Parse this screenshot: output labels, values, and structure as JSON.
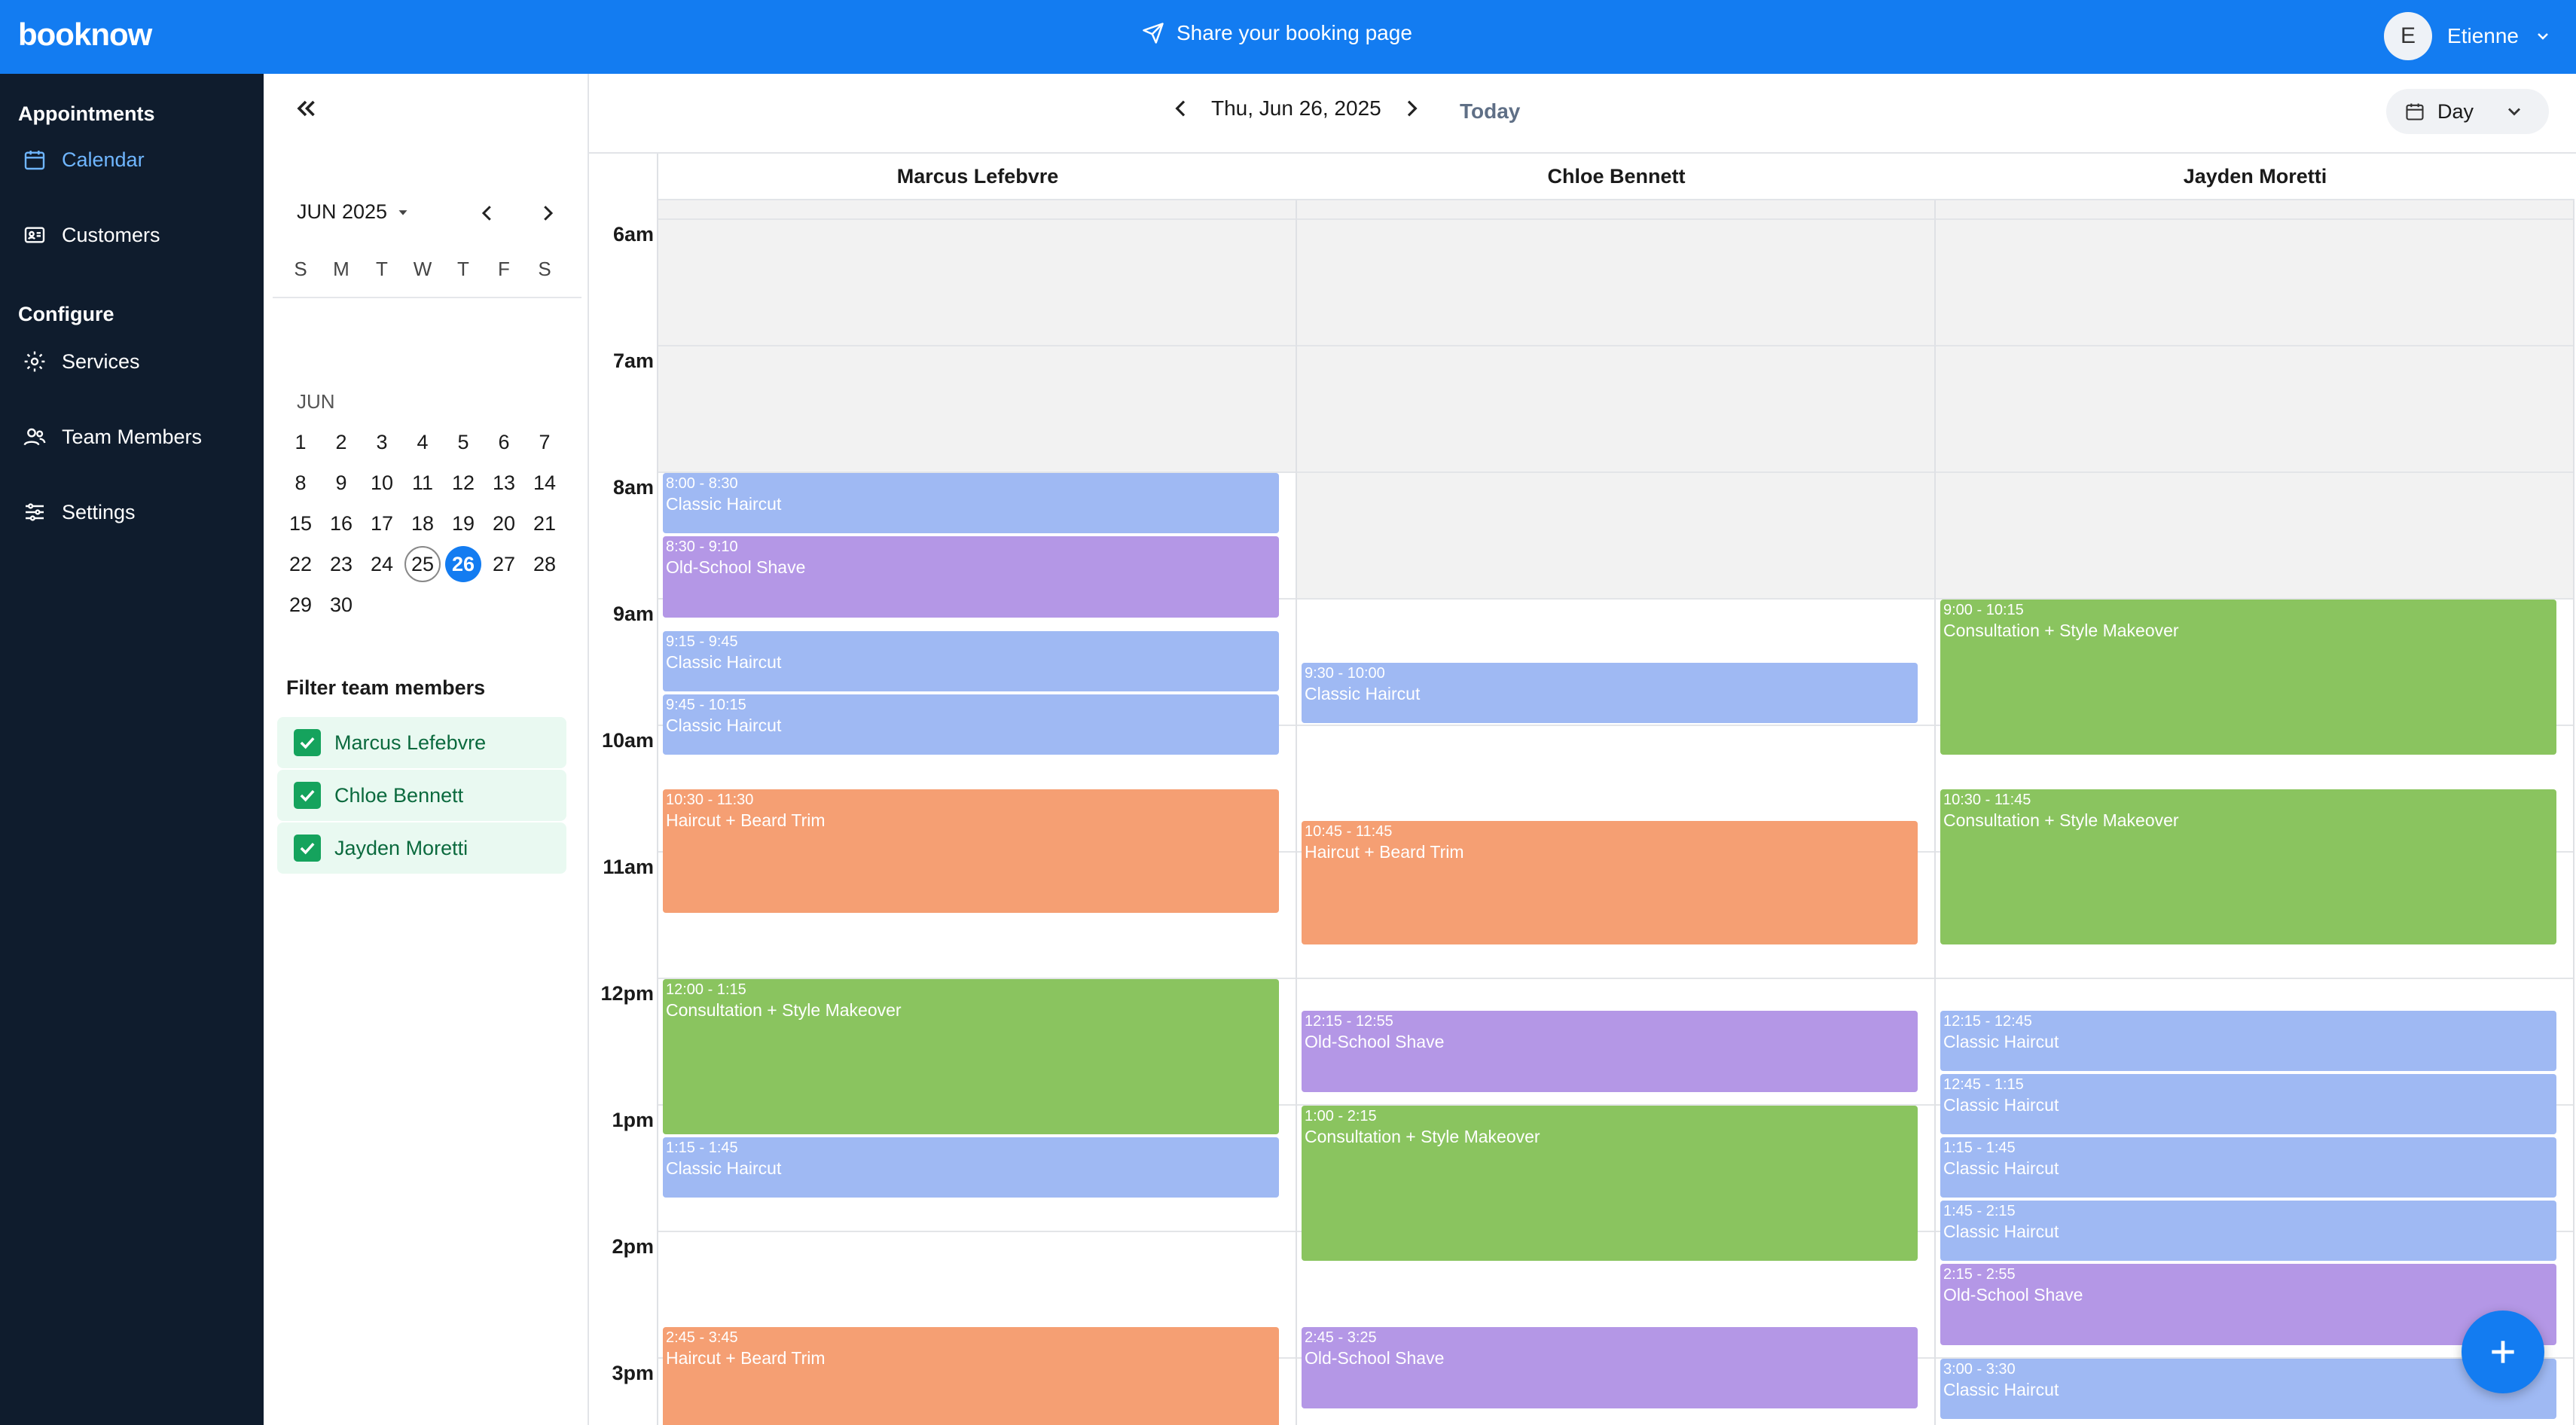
{
  "app": {
    "logo": "booknow",
    "share_label": "Share your booking page",
    "user_initial": "E",
    "user_name": "Etienne"
  },
  "sidebar": {
    "sections": [
      "Appointments",
      "Configure"
    ],
    "items": [
      {
        "label": "Calendar",
        "icon": "calendar-icon",
        "active": true
      },
      {
        "label": "Customers",
        "icon": "id-card-icon"
      },
      {
        "label": "Services",
        "icon": "gear-icon"
      },
      {
        "label": "Team Members",
        "icon": "users-icon"
      },
      {
        "label": "Settings",
        "icon": "sliders-icon"
      }
    ]
  },
  "mini_calendar": {
    "month_label": "JUN 2025",
    "weekdays": [
      "S",
      "M",
      "T",
      "W",
      "T",
      "F",
      "S"
    ],
    "month_short": "JUN",
    "days": [
      "1",
      "2",
      "3",
      "4",
      "5",
      "6",
      "7",
      "8",
      "9",
      "10",
      "11",
      "12",
      "13",
      "14",
      "15",
      "16",
      "17",
      "18",
      "19",
      "20",
      "21",
      "22",
      "23",
      "24",
      "25",
      "26",
      "27",
      "28",
      "29",
      "30"
    ],
    "today": "25",
    "selected": "26"
  },
  "filter": {
    "title": "Filter team members",
    "members": [
      "Marcus Lefebvre",
      "Chloe Bennett",
      "Jayden Moretti"
    ]
  },
  "datebar": {
    "date_label": "Thu, Jun 26, 2025",
    "today_label": "Today",
    "view_label": "Day"
  },
  "hours": [
    "6am",
    "7am",
    "8am",
    "9am",
    "10am",
    "11am",
    "12pm",
    "1pm",
    "2pm",
    "3pm"
  ],
  "columns": [
    {
      "name": "Marcus Lefebvre",
      "available_from": 8,
      "appointments": [
        {
          "time": "8:00 - 8:30",
          "service": "Classic Haircut",
          "start": 8.0,
          "end": 8.5,
          "kind": "haircut"
        },
        {
          "time": "8:30 - 9:10",
          "service": "Old-School Shave",
          "start": 8.5,
          "end": 9.1667,
          "kind": "shave"
        },
        {
          "time": "9:15 - 9:45",
          "service": "Classic Haircut",
          "start": 9.25,
          "end": 9.75,
          "kind": "haircut"
        },
        {
          "time": "9:45 - 10:15",
          "service": "Classic Haircut",
          "start": 9.75,
          "end": 10.25,
          "kind": "haircut"
        },
        {
          "time": "10:30 - 11:30",
          "service": "Haircut + Beard Trim",
          "start": 10.5,
          "end": 11.5,
          "kind": "beard"
        },
        {
          "time": "12:00 - 1:15",
          "service": "Consultation + Style Makeover",
          "start": 12.0,
          "end": 13.25,
          "kind": "consult"
        },
        {
          "time": "1:15 - 1:45",
          "service": "Classic Haircut",
          "start": 13.25,
          "end": 13.75,
          "kind": "haircut"
        },
        {
          "time": "2:45 - 3:45",
          "service": "Haircut + Beard Trim",
          "start": 14.75,
          "end": 15.75,
          "kind": "beard"
        }
      ]
    },
    {
      "name": "Chloe Bennett",
      "available_from": 9,
      "appointments": [
        {
          "time": "9:30 - 10:00",
          "service": "Classic Haircut",
          "start": 9.5,
          "end": 10.0,
          "kind": "haircut"
        },
        {
          "time": "10:45 - 11:45",
          "service": "Haircut + Beard Trim",
          "start": 10.75,
          "end": 11.75,
          "kind": "beard"
        },
        {
          "time": "12:15 - 12:55",
          "service": "Old-School Shave",
          "start": 12.25,
          "end": 12.9167,
          "kind": "shave"
        },
        {
          "time": "1:00 - 2:15",
          "service": "Consultation + Style Makeover",
          "start": 13.0,
          "end": 14.25,
          "kind": "consult"
        },
        {
          "time": "2:45 - 3:25",
          "service": "Old-School Shave",
          "start": 14.75,
          "end": 15.4167,
          "kind": "shave"
        }
      ]
    },
    {
      "name": "Jayden Moretti",
      "available_from": 9,
      "appointments": [
        {
          "time": "9:00 - 10:15",
          "service": "Consultation + Style Makeover",
          "start": 9.0,
          "end": 10.25,
          "kind": "consult"
        },
        {
          "time": "10:30 - 11:45",
          "service": "Consultation + Style Makeover",
          "start": 10.5,
          "end": 11.75,
          "kind": "consult"
        },
        {
          "time": "12:15 - 12:45",
          "service": "Classic Haircut",
          "start": 12.25,
          "end": 12.75,
          "kind": "haircut"
        },
        {
          "time": "12:45 - 1:15",
          "service": "Classic Haircut",
          "start": 12.75,
          "end": 13.25,
          "kind": "haircut"
        },
        {
          "time": "1:15 - 1:45",
          "service": "Classic Haircut",
          "start": 13.25,
          "end": 13.75,
          "kind": "haircut"
        },
        {
          "time": "1:45 - 2:15",
          "service": "Classic Haircut",
          "start": 13.75,
          "end": 14.25,
          "kind": "haircut"
        },
        {
          "time": "2:15 - 2:55",
          "service": "Old-School Shave",
          "start": 14.25,
          "end": 14.9167,
          "kind": "shave"
        },
        {
          "time": "3:00 - 3:30",
          "service": "Classic Haircut",
          "start": 15.0,
          "end": 15.5,
          "kind": "haircut"
        }
      ]
    }
  ],
  "colors": {
    "brand": "#137cf1",
    "sidebar": "#0f1c2d",
    "haircut": "#9fb9f3",
    "shave": "#b497e6",
    "beard": "#f59f73",
    "consult": "#8ac45f"
  }
}
